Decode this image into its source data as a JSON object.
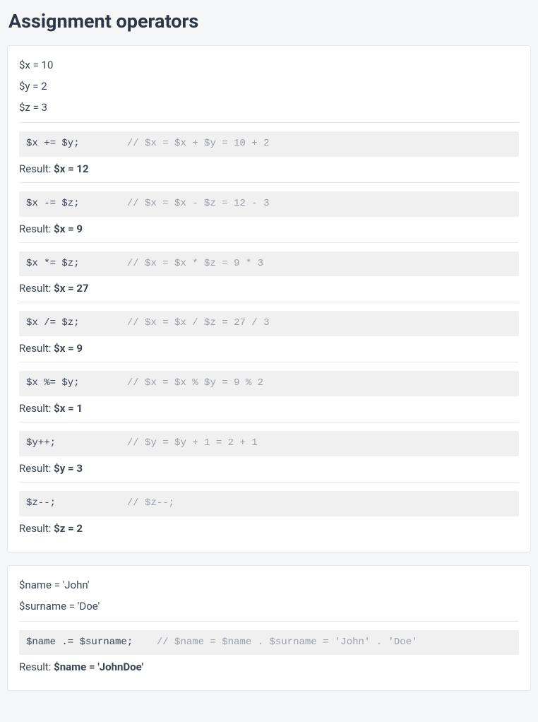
{
  "heading": "Assignment operators",
  "result_label": "Result: ",
  "card1": {
    "vars": [
      "$x = 10",
      "$y = 2",
      "$z = 3"
    ],
    "sections": [
      {
        "stmt": "$x += $y;",
        "comment": "// $x = $x + $y = 10 + 2",
        "result": "$x = 12"
      },
      {
        "stmt": "$x -= $z;",
        "comment": "// $x = $x - $z = 12 - 3",
        "result": "$x = 9"
      },
      {
        "stmt": "$x *= $z;",
        "comment": "// $x = $x * $z = 9 * 3",
        "result": "$x = 27"
      },
      {
        "stmt": "$x /= $z;",
        "comment": "// $x = $x / $z = 27 / 3",
        "result": "$x = 9"
      },
      {
        "stmt": "$x %= $y;",
        "comment": "// $x = $x % $y = 9 % 2",
        "result": "$x = 1"
      },
      {
        "stmt": "$y++;",
        "comment": "// $y = $y + 1 = 2 + 1",
        "result": "$y = 3"
      },
      {
        "stmt": "$z--;",
        "comment": "// $z--;",
        "result": "$z = 2"
      }
    ]
  },
  "card2": {
    "vars": [
      "$name = 'John'",
      "$surname = 'Doe'"
    ],
    "sections": [
      {
        "stmt": "$name .= $surname;",
        "comment": "// $name = $name . $surname = 'John' . 'Doe'",
        "result": "$name = 'JohnDoe'"
      }
    ]
  }
}
